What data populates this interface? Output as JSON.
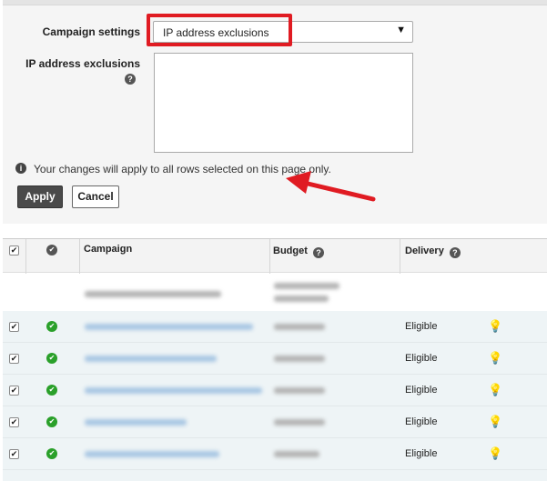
{
  "form": {
    "campaign_settings_label": "Campaign settings",
    "campaign_settings_value": "IP address exclusions",
    "ip_exclusions_label": "IP address exclusions",
    "info_text": "Your changes will apply to all rows selected on this page only.",
    "apply_label": "Apply",
    "cancel_label": "Cancel"
  },
  "annotation": {
    "highlight_color": "#e01b22"
  },
  "table": {
    "columns": [
      "Campaign",
      "Budget",
      "Delivery"
    ],
    "rows": [
      {
        "checked": true,
        "status": "eligible",
        "delivery": "Eligible"
      },
      {
        "checked": true,
        "status": "eligible",
        "delivery": "Eligible"
      },
      {
        "checked": true,
        "status": "eligible",
        "delivery": "Eligible"
      },
      {
        "checked": true,
        "status": "eligible",
        "delivery": "Eligible"
      },
      {
        "checked": true,
        "status": "eligible",
        "delivery": "Eligible"
      }
    ]
  },
  "icons": {
    "help": "question-mark-icon",
    "info": "info-icon",
    "status_ok": "check-circle-icon",
    "opportunity": "lightbulb-icon",
    "dropdown": "triangle-down-icon"
  }
}
